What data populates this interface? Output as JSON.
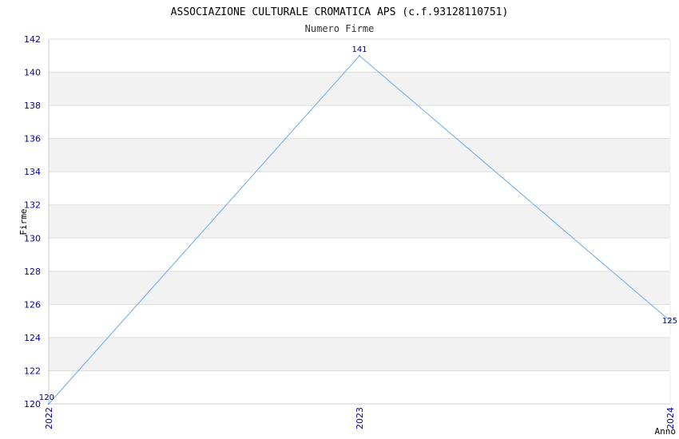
{
  "chart_data": {
    "type": "line",
    "title": "ASSOCIAZIONE CULTURALE CROMATICA APS (c.f.93128110751)",
    "subtitle": "Numero Firme",
    "xlabel": "Anno",
    "ylabel": "Firme",
    "categories": [
      "2022",
      "2023",
      "2024"
    ],
    "series": [
      {
        "values": [
          120,
          141,
          125
        ]
      }
    ],
    "data_labels": [
      "120",
      "141",
      "125"
    ],
    "ylim": [
      120,
      142
    ],
    "yticks": [
      120,
      122,
      124,
      126,
      128,
      130,
      132,
      134,
      136,
      138,
      140,
      142
    ],
    "grid": true,
    "colors": {
      "line": "#66aaee",
      "band": "#f2f2f2",
      "gridline": "#dddddd",
      "tick_text": "#0000aa",
      "data_label": "#000066"
    }
  }
}
